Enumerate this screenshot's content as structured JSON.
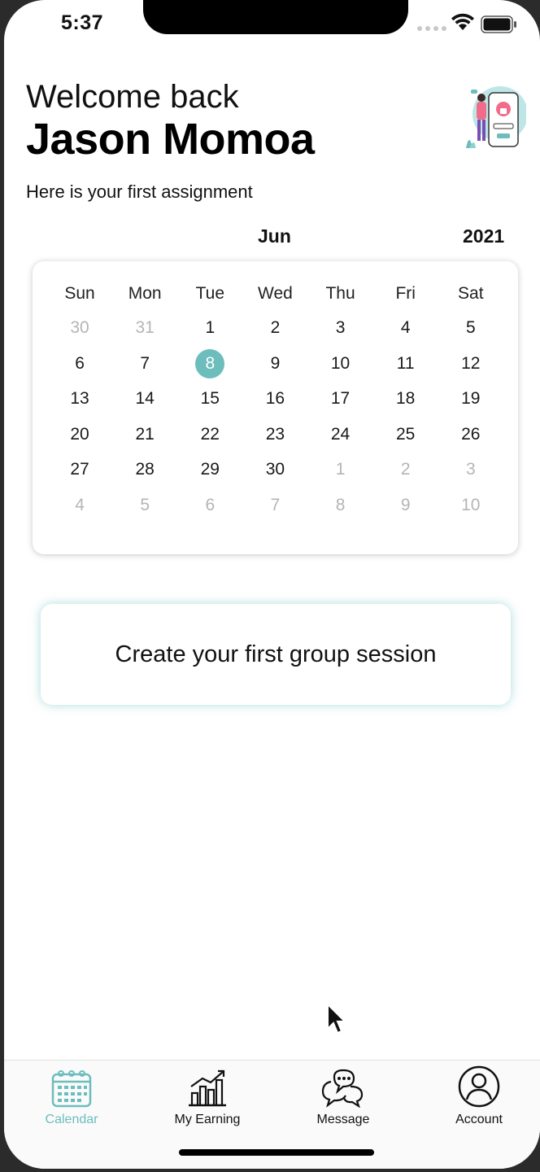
{
  "status_bar": {
    "time": "5:37"
  },
  "header": {
    "welcome": "Welcome back",
    "name": "Jason Momoa",
    "subtitle": "Here is your first assignment"
  },
  "calendar": {
    "month": "Jun",
    "year": "2021",
    "weekdays": [
      "Sun",
      "Mon",
      "Tue",
      "Wed",
      "Thu",
      "Fri",
      "Sat"
    ],
    "days": [
      {
        "d": "30",
        "muted": true
      },
      {
        "d": "31",
        "muted": true
      },
      {
        "d": "1"
      },
      {
        "d": "2"
      },
      {
        "d": "3"
      },
      {
        "d": "4"
      },
      {
        "d": "5"
      },
      {
        "d": "6"
      },
      {
        "d": "7"
      },
      {
        "d": "8",
        "selected": true
      },
      {
        "d": "9"
      },
      {
        "d": "10"
      },
      {
        "d": "11"
      },
      {
        "d": "12"
      },
      {
        "d": "13"
      },
      {
        "d": "14"
      },
      {
        "d": "15"
      },
      {
        "d": "16"
      },
      {
        "d": "17"
      },
      {
        "d": "18"
      },
      {
        "d": "19"
      },
      {
        "d": "20"
      },
      {
        "d": "21"
      },
      {
        "d": "22"
      },
      {
        "d": "23"
      },
      {
        "d": "24"
      },
      {
        "d": "25"
      },
      {
        "d": "26"
      },
      {
        "d": "27"
      },
      {
        "d": "28"
      },
      {
        "d": "29"
      },
      {
        "d": "30"
      },
      {
        "d": "1",
        "muted": true
      },
      {
        "d": "2",
        "muted": true
      },
      {
        "d": "3",
        "muted": true
      },
      {
        "d": "4",
        "muted": true
      },
      {
        "d": "5",
        "muted": true
      },
      {
        "d": "6",
        "muted": true
      },
      {
        "d": "7",
        "muted": true
      },
      {
        "d": "8",
        "muted": true
      },
      {
        "d": "9",
        "muted": true
      },
      {
        "d": "10",
        "muted": true
      }
    ],
    "selected_color": "#6dbdbd"
  },
  "actions": {
    "create_session": "Create your first group session"
  },
  "tabbar": {
    "accent": "#6dbdbd",
    "tabs": [
      {
        "label": "Calendar",
        "icon": "calendar-icon",
        "active": true
      },
      {
        "label": "My Earning",
        "icon": "bar-chart-icon"
      },
      {
        "label": "Message",
        "icon": "chat-bubbles-icon"
      },
      {
        "label": "Account",
        "icon": "user-circle-icon"
      }
    ]
  }
}
